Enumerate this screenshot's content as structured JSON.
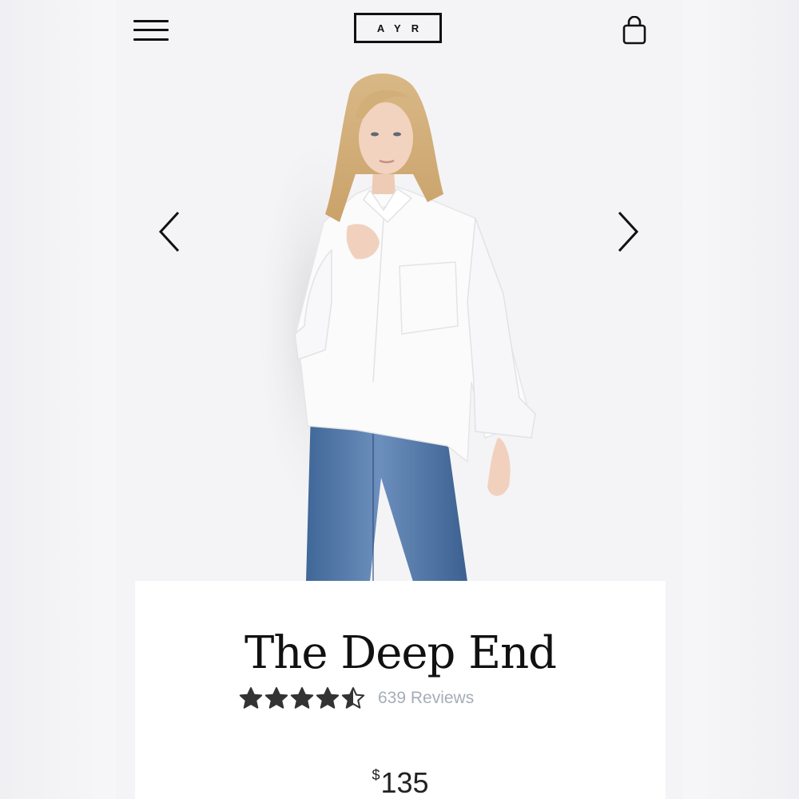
{
  "header": {
    "logo_text": "AYR"
  },
  "hero": {
    "carousel_position": "first"
  },
  "product": {
    "title": "The Deep End",
    "rating": 4.5,
    "rating_max": 5,
    "reviews_label": "639 Reviews",
    "price_currency": "$",
    "price_value": "135"
  },
  "icons": {
    "menu": "menu-icon",
    "bag": "shopping-bag-icon",
    "prev": "chevron-left-icon",
    "next": "chevron-right-icon",
    "star": "star-icon"
  },
  "colors": {
    "text": "#111111",
    "reviews": "#a6adb6",
    "star": "#333333",
    "denim": "#4a6f9c",
    "shirt": "#fbfbfb"
  }
}
